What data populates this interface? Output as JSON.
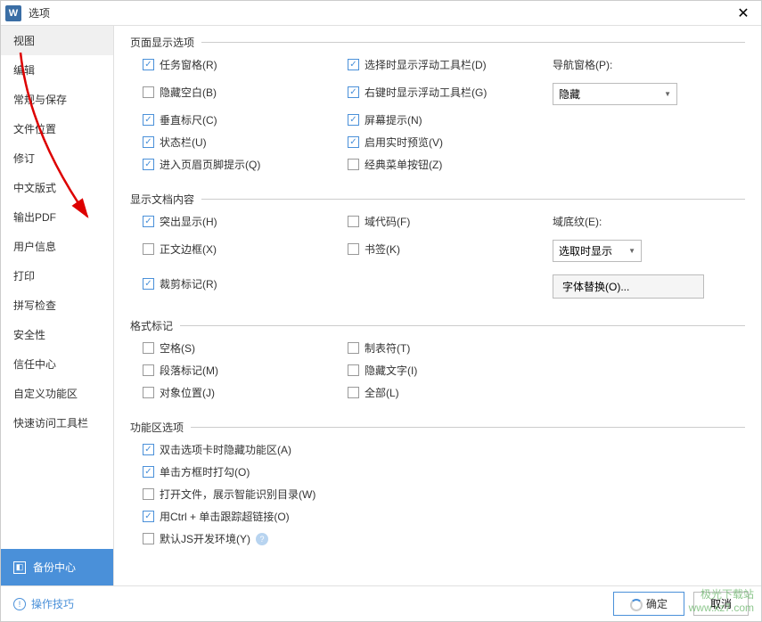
{
  "title": "选项",
  "sidebar": {
    "items": [
      {
        "label": "视图"
      },
      {
        "label": "编辑"
      },
      {
        "label": "常规与保存"
      },
      {
        "label": "文件位置"
      },
      {
        "label": "修订"
      },
      {
        "label": "中文版式"
      },
      {
        "label": "输出PDF"
      },
      {
        "label": "用户信息"
      },
      {
        "label": "打印"
      },
      {
        "label": "拼写检查"
      },
      {
        "label": "安全性"
      },
      {
        "label": "信任中心"
      },
      {
        "label": "自定义功能区"
      },
      {
        "label": "快速访问工具栏"
      }
    ],
    "backup": "备份中心"
  },
  "sections": {
    "pageDisplay": {
      "legend": "页面显示选项",
      "items": {
        "taskPane": "任务窗格(R)",
        "hideBlank": "隐藏空白(B)",
        "vRuler": "垂直标尺(C)",
        "statusBar": "状态栏(U)",
        "headerFooter": "进入页眉页脚提示(Q)",
        "selectFloat": "选择时显示浮动工具栏(D)",
        "rightFloat": "右键时显示浮动工具栏(G)",
        "screenTip": "屏幕提示(N)",
        "livePreview": "启用实时预览(V)",
        "classicMenu": "经典菜单按钮(Z)",
        "navLabel": "导航窗格(P):",
        "navValue": "隐藏"
      }
    },
    "docContent": {
      "legend": "显示文档内容",
      "items": {
        "highlight": "突出显示(H)",
        "textBorder": "正文边框(X)",
        "cropMark": "裁剪标记(R)",
        "fieldCode": "域代码(F)",
        "bookmark": "书签(K)",
        "shadingLabel": "域底纹(E):",
        "shadingValue": "选取时显示",
        "fontReplace": "字体替换(O)..."
      }
    },
    "formatMark": {
      "legend": "格式标记",
      "items": {
        "space": "空格(S)",
        "paraMark": "段落标记(M)",
        "objPos": "对象位置(J)",
        "tab": "制表符(T)",
        "hiddenText": "隐藏文字(I)",
        "all": "全部(L)"
      }
    },
    "ribbon": {
      "legend": "功能区选项",
      "items": {
        "dblHide": "双击选项卡时隐藏功能区(A)",
        "clickCheck": "单击方框时打勾(O)",
        "openSmart": "打开文件，展示智能识别目录(W)",
        "ctrlLink": "用Ctrl + 单击跟踪超链接(O)",
        "jsDev": "默认JS开发环境(Y)"
      }
    }
  },
  "footer": {
    "tips": "操作技巧",
    "ok": "确定",
    "cancel": "取消"
  },
  "watermark": {
    "line1": "极光下载站",
    "line2": "www.xz7.com"
  }
}
